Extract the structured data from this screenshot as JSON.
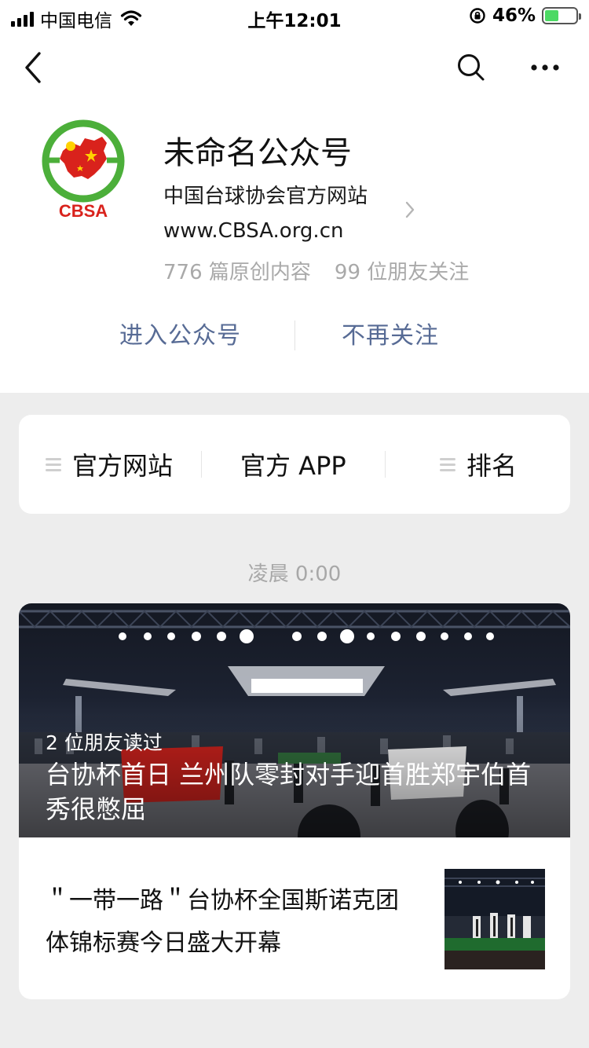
{
  "status_bar": {
    "carrier": "中国电信",
    "time": "上午12:01",
    "battery_percent": "46%",
    "battery_level": 0.46
  },
  "nav": {
    "back_icon": "chevron-left-icon",
    "search_icon": "search-icon",
    "more_icon": "more-icon"
  },
  "profile": {
    "logo_text": "CBSA",
    "name": "未命名公众号",
    "description_line1": "中国台球协会官方网站",
    "description_line2": "www.CBSA.org.cn",
    "original_count": "776 篇原创内容",
    "friends_following": "99 位朋友关注"
  },
  "actions": {
    "enter": "进入公众号",
    "unfollow": "不再关注"
  },
  "menu": {
    "items": [
      {
        "label": "官方网站",
        "has_icon": true
      },
      {
        "label": "官方 APP",
        "has_icon": false
      },
      {
        "label": "排名",
        "has_icon": true
      }
    ]
  },
  "feed": {
    "time": "凌晨 0:00",
    "main_article": {
      "readers": "2 位朋友读过",
      "title": "台协杯首日 兰州队零封对手迎首胜郑宇伯首秀很憋屈"
    },
    "sub_article": {
      "title": "＂一带一路＂台协杯全国斯诺克团体锦标赛今日盛大开幕"
    }
  },
  "colors": {
    "link": "#576b95",
    "background": "#ededed",
    "logo_red": "#d9221c",
    "logo_green": "#4caf3a",
    "battery_green": "#4cd964"
  }
}
